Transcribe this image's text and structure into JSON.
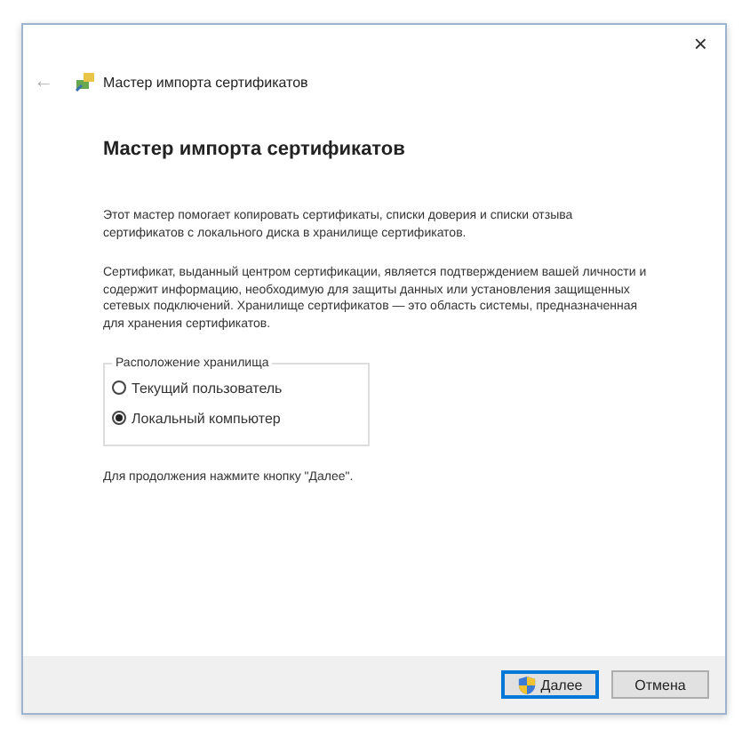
{
  "window": {
    "title": "Мастер импорта сертификатов",
    "close": "×",
    "back": "←"
  },
  "heading": "Мастер импорта сертификатов",
  "paragraphs": [
    "Этот мастер помогает копировать сертификаты, списки доверия и списки отзыва сертификатов с локального диска в хранилище сертификатов.",
    "Сертификат, выданный центром сертификации, является подтверждением вашей личности и содержит информацию, необходимую для защиты данных или установления защищенных сетевых подключений. Хранилище сертификатов — это область системы, предназначенная для хранения сертификатов."
  ],
  "store_location": {
    "legend": "Расположение хранилища",
    "options": [
      {
        "label": "Текущий пользователь",
        "selected": false
      },
      {
        "label": "Локальный компьютер",
        "selected": true
      }
    ]
  },
  "hint": "Для продолжения нажмите кнопку \"Далее\".",
  "buttons": [
    {
      "label": "Далее",
      "kind": "primary"
    },
    {
      "label": "Отмена",
      "kind": "normal"
    }
  ]
}
